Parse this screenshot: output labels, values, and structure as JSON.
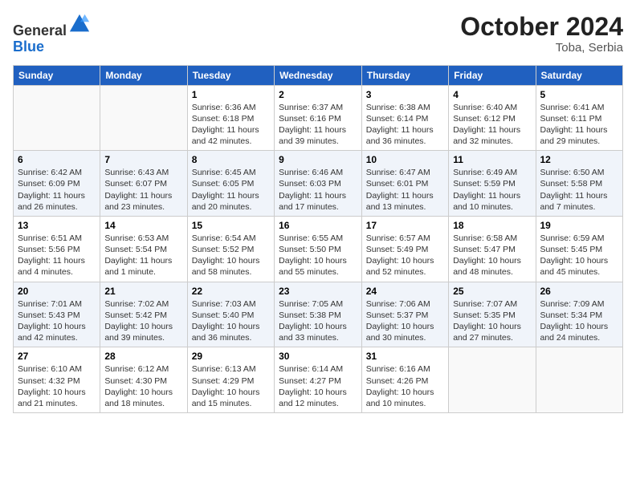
{
  "header": {
    "logo_line1": "General",
    "logo_line2": "Blue",
    "month_title": "October 2024",
    "location": "Toba, Serbia"
  },
  "weekdays": [
    "Sunday",
    "Monday",
    "Tuesday",
    "Wednesday",
    "Thursday",
    "Friday",
    "Saturday"
  ],
  "weeks": [
    [
      {
        "day": "",
        "info": ""
      },
      {
        "day": "",
        "info": ""
      },
      {
        "day": "1",
        "info": "Sunrise: 6:36 AM\nSunset: 6:18 PM\nDaylight: 11 hours and 42 minutes."
      },
      {
        "day": "2",
        "info": "Sunrise: 6:37 AM\nSunset: 6:16 PM\nDaylight: 11 hours and 39 minutes."
      },
      {
        "day": "3",
        "info": "Sunrise: 6:38 AM\nSunset: 6:14 PM\nDaylight: 11 hours and 36 minutes."
      },
      {
        "day": "4",
        "info": "Sunrise: 6:40 AM\nSunset: 6:12 PM\nDaylight: 11 hours and 32 minutes."
      },
      {
        "day": "5",
        "info": "Sunrise: 6:41 AM\nSunset: 6:11 PM\nDaylight: 11 hours and 29 minutes."
      }
    ],
    [
      {
        "day": "6",
        "info": "Sunrise: 6:42 AM\nSunset: 6:09 PM\nDaylight: 11 hours and 26 minutes."
      },
      {
        "day": "7",
        "info": "Sunrise: 6:43 AM\nSunset: 6:07 PM\nDaylight: 11 hours and 23 minutes."
      },
      {
        "day": "8",
        "info": "Sunrise: 6:45 AM\nSunset: 6:05 PM\nDaylight: 11 hours and 20 minutes."
      },
      {
        "day": "9",
        "info": "Sunrise: 6:46 AM\nSunset: 6:03 PM\nDaylight: 11 hours and 17 minutes."
      },
      {
        "day": "10",
        "info": "Sunrise: 6:47 AM\nSunset: 6:01 PM\nDaylight: 11 hours and 13 minutes."
      },
      {
        "day": "11",
        "info": "Sunrise: 6:49 AM\nSunset: 5:59 PM\nDaylight: 11 hours and 10 minutes."
      },
      {
        "day": "12",
        "info": "Sunrise: 6:50 AM\nSunset: 5:58 PM\nDaylight: 11 hours and 7 minutes."
      }
    ],
    [
      {
        "day": "13",
        "info": "Sunrise: 6:51 AM\nSunset: 5:56 PM\nDaylight: 11 hours and 4 minutes."
      },
      {
        "day": "14",
        "info": "Sunrise: 6:53 AM\nSunset: 5:54 PM\nDaylight: 11 hours and 1 minute."
      },
      {
        "day": "15",
        "info": "Sunrise: 6:54 AM\nSunset: 5:52 PM\nDaylight: 10 hours and 58 minutes."
      },
      {
        "day": "16",
        "info": "Sunrise: 6:55 AM\nSunset: 5:50 PM\nDaylight: 10 hours and 55 minutes."
      },
      {
        "day": "17",
        "info": "Sunrise: 6:57 AM\nSunset: 5:49 PM\nDaylight: 10 hours and 52 minutes."
      },
      {
        "day": "18",
        "info": "Sunrise: 6:58 AM\nSunset: 5:47 PM\nDaylight: 10 hours and 48 minutes."
      },
      {
        "day": "19",
        "info": "Sunrise: 6:59 AM\nSunset: 5:45 PM\nDaylight: 10 hours and 45 minutes."
      }
    ],
    [
      {
        "day": "20",
        "info": "Sunrise: 7:01 AM\nSunset: 5:43 PM\nDaylight: 10 hours and 42 minutes."
      },
      {
        "day": "21",
        "info": "Sunrise: 7:02 AM\nSunset: 5:42 PM\nDaylight: 10 hours and 39 minutes."
      },
      {
        "day": "22",
        "info": "Sunrise: 7:03 AM\nSunset: 5:40 PM\nDaylight: 10 hours and 36 minutes."
      },
      {
        "day": "23",
        "info": "Sunrise: 7:05 AM\nSunset: 5:38 PM\nDaylight: 10 hours and 33 minutes."
      },
      {
        "day": "24",
        "info": "Sunrise: 7:06 AM\nSunset: 5:37 PM\nDaylight: 10 hours and 30 minutes."
      },
      {
        "day": "25",
        "info": "Sunrise: 7:07 AM\nSunset: 5:35 PM\nDaylight: 10 hours and 27 minutes."
      },
      {
        "day": "26",
        "info": "Sunrise: 7:09 AM\nSunset: 5:34 PM\nDaylight: 10 hours and 24 minutes."
      }
    ],
    [
      {
        "day": "27",
        "info": "Sunrise: 6:10 AM\nSunset: 4:32 PM\nDaylight: 10 hours and 21 minutes."
      },
      {
        "day": "28",
        "info": "Sunrise: 6:12 AM\nSunset: 4:30 PM\nDaylight: 10 hours and 18 minutes."
      },
      {
        "day": "29",
        "info": "Sunrise: 6:13 AM\nSunset: 4:29 PM\nDaylight: 10 hours and 15 minutes."
      },
      {
        "day": "30",
        "info": "Sunrise: 6:14 AM\nSunset: 4:27 PM\nDaylight: 10 hours and 12 minutes."
      },
      {
        "day": "31",
        "info": "Sunrise: 6:16 AM\nSunset: 4:26 PM\nDaylight: 10 hours and 10 minutes."
      },
      {
        "day": "",
        "info": ""
      },
      {
        "day": "",
        "info": ""
      }
    ]
  ]
}
